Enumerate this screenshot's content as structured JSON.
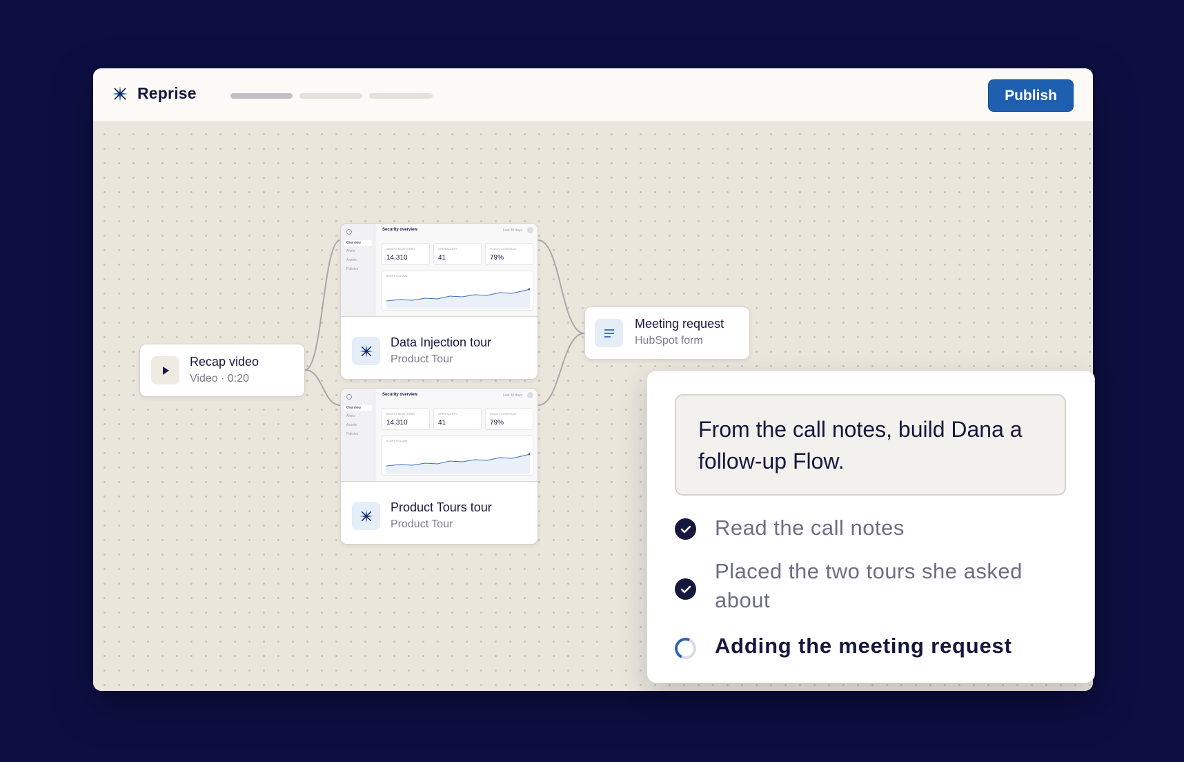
{
  "app": {
    "name": "Reprise",
    "publish_label": "Publish",
    "progress_steps": 3,
    "progress_completed": 1
  },
  "nodes": {
    "recap_video": {
      "title": "Recap video",
      "subtitle": "Video · 0:20"
    },
    "data_injection_tour": {
      "title": "Data Injection tour",
      "subtitle": "Product Tour",
      "thumbnail": {
        "title": "Security overview",
        "range": "Last 30 days",
        "nav": [
          "Overview",
          "Alerts",
          "Assets",
          "Policies"
        ],
        "metrics": [
          {
            "label": "ASSETS MONITORED",
            "value": "14,310"
          },
          {
            "label": "OPEN ALERTS",
            "value": "41"
          },
          {
            "label": "POLICY COVERAGE",
            "value": "79%"
          }
        ],
        "chart_label": "ALERT VOLUME"
      }
    },
    "product_tours_tour": {
      "title": "Product Tours tour",
      "subtitle": "Product Tour",
      "thumbnail": {
        "title": "Security overview",
        "range": "Last 30 days",
        "nav": [
          "Overview",
          "Alerts",
          "Assets",
          "Policies"
        ],
        "metrics": [
          {
            "label": "ASSETS MONITORED",
            "value": "14,310"
          },
          {
            "label": "OPEN ALERTS",
            "value": "41"
          },
          {
            "label": "POLICY COVERAGE",
            "value": "79%"
          }
        ],
        "chart_label": "ALERT VOLUME"
      }
    },
    "meeting_request": {
      "title": "Meeting request",
      "subtitle": "HubSpot form"
    }
  },
  "assistant": {
    "prompt": "From the call notes, build Dana a follow-up Flow.",
    "steps": [
      {
        "text": "Read the call notes",
        "status": "done"
      },
      {
        "text": "Placed the two tours she asked about",
        "status": "done"
      },
      {
        "text": "Adding the meeting request",
        "status": "in-progress"
      }
    ]
  },
  "colors": {
    "background": "#0d0f42",
    "canvas": "#eae6dc",
    "accent": "#1f5fb0",
    "text": "#15173f"
  }
}
